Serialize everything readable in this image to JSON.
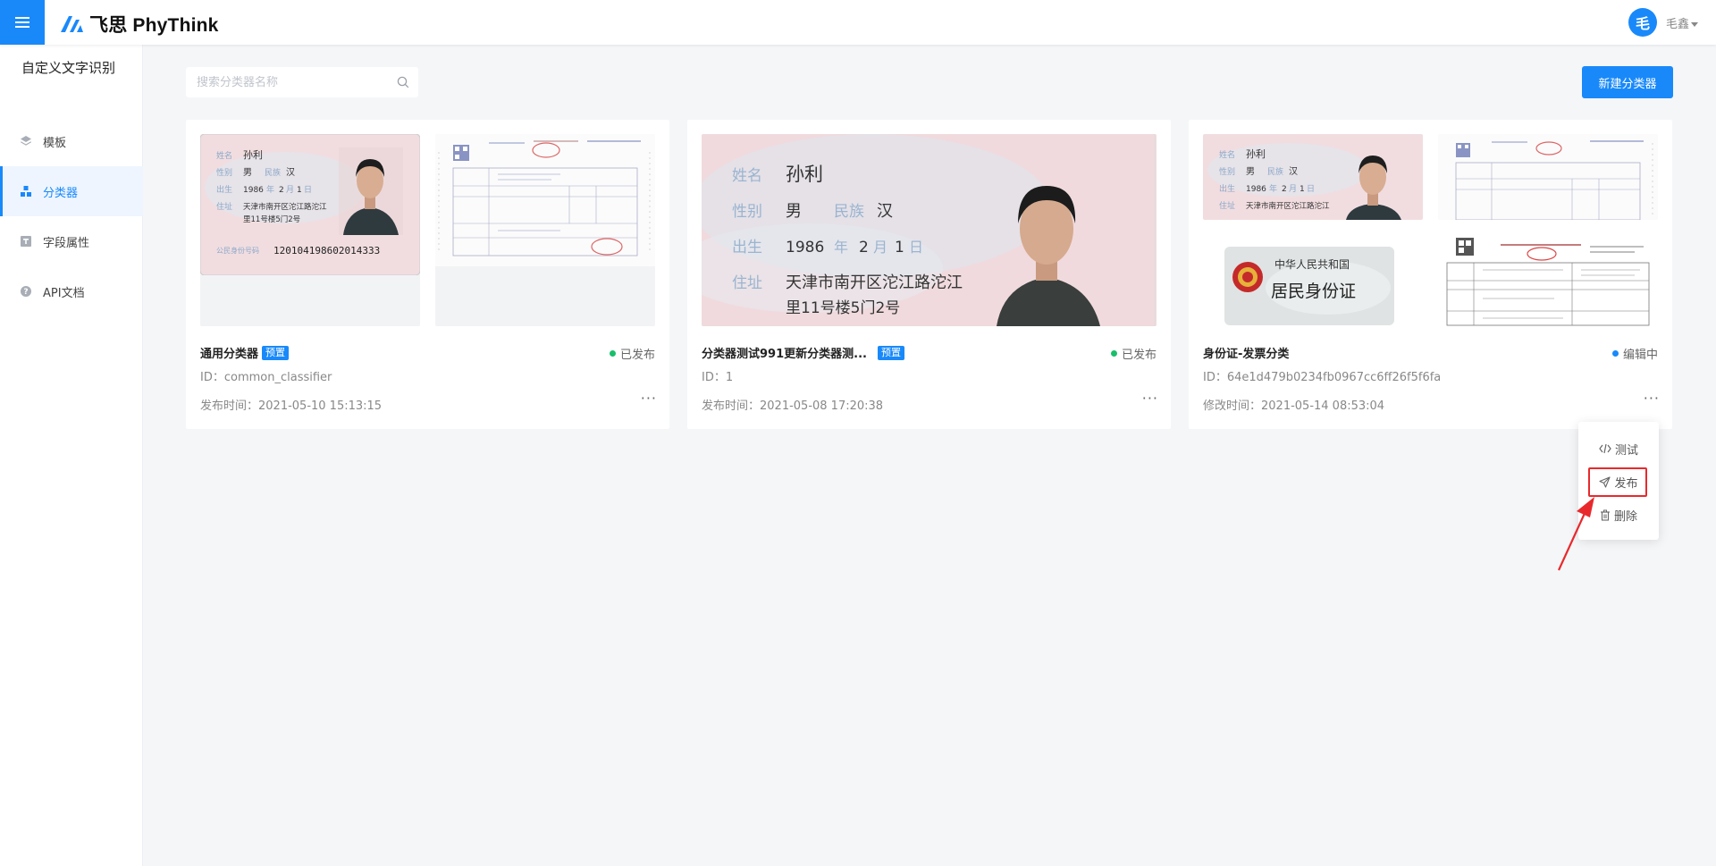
{
  "header": {
    "brand": "飞思 PhyThink",
    "avatar_initial": "毛",
    "username": "毛鑫"
  },
  "sidebar": {
    "title": "自定义文字识别",
    "items": [
      {
        "label": "模板",
        "icon": "layers-icon",
        "active": false
      },
      {
        "label": "分类器",
        "icon": "classifier-icon",
        "active": true
      },
      {
        "label": "字段属性",
        "icon": "text-field-icon",
        "active": false
      },
      {
        "label": "API文档",
        "icon": "help-circle-icon",
        "active": false
      }
    ]
  },
  "search": {
    "placeholder": "搜索分类器名称",
    "value": ""
  },
  "toolbar": {
    "new_label": "新建分类器"
  },
  "cards": [
    {
      "title": "通用分类器",
      "badge": "预置",
      "status": "已发布",
      "status_color": "#19be6b",
      "id_text": "ID：common_classifier",
      "time_text": "发布时间：2021-05-10 15:13:15",
      "more": "···"
    },
    {
      "title": "分类器测试991更新分类器测...",
      "badge": "预置",
      "status": "已发布",
      "status_color": "#19be6b",
      "id_text": "ID：1",
      "time_text": "发布时间：2021-05-08 17:20:38",
      "more": "···"
    },
    {
      "title": "身份证-发票分类",
      "badge": "",
      "status": "编辑中",
      "status_color": "#1989fa",
      "id_text": "ID：64e1d479b0234fb0967cc6ff26f5f6fa",
      "time_text": "修改时间：2021-05-14 08:53:04",
      "more": "···"
    }
  ],
  "id_card": {
    "name_label": "姓名",
    "name": "孙利",
    "sex_label": "性别",
    "sex": "男",
    "ethnicity_label": "民族",
    "ethnicity": "汉",
    "birth_label": "出生",
    "birth_year": "1986",
    "birth_year_unit": "年",
    "birth_month": "2",
    "birth_month_unit": "月",
    "birth_day": "1",
    "birth_day_unit": "日",
    "address_label": "住址",
    "address_line1": "天津市南开区沱江路沱江",
    "address_line2": "里11号楼5门2号",
    "id_number_label": "公民身份号码",
    "id_number": "120104198602014333"
  },
  "id_card_back": {
    "country": "中华人民共和国",
    "doc_name": "居民身份证"
  },
  "dropdown": {
    "items": [
      {
        "label": "测试",
        "icon": "code-icon"
      },
      {
        "label": "发布",
        "icon": "send-icon"
      },
      {
        "label": "删除",
        "icon": "trash-icon"
      }
    ]
  }
}
